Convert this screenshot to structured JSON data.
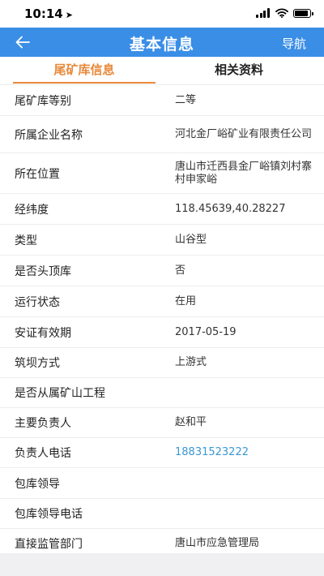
{
  "status_bar": {
    "time": "10:14"
  },
  "nav": {
    "title": "基本信息",
    "right_label": "导航"
  },
  "tabs": [
    {
      "label": "尾矿库信息",
      "active": true
    },
    {
      "label": "相关资料",
      "active": false
    }
  ],
  "rows": [
    {
      "label": "尾矿库等别",
      "value": "二等"
    },
    {
      "label": "所属企业名称",
      "value": "河北金厂峪矿业有限责任公司"
    },
    {
      "label": "所在位置",
      "value": "唐山市迁西县金厂峪镇刘村寨村申家峪"
    },
    {
      "label": "经纬度",
      "value": "118.45639,40.28227"
    },
    {
      "label": "类型",
      "value": "山谷型"
    },
    {
      "label": "是否头顶库",
      "value": "否"
    },
    {
      "label": "运行状态",
      "value": "在用"
    },
    {
      "label": "安证有效期",
      "value": "2017-05-19"
    },
    {
      "label": "筑坝方式",
      "value": "上游式"
    },
    {
      "label": "是否从属矿山工程",
      "value": ""
    },
    {
      "label": "主要负责人",
      "value": "赵和平"
    },
    {
      "label": "负责人电话",
      "value": "18831523222"
    },
    {
      "label": "包库领导",
      "value": ""
    },
    {
      "label": "包库领导电话",
      "value": ""
    },
    {
      "label": "直接监管部门",
      "value": "唐山市应急管理局"
    }
  ],
  "colors": {
    "nav_bg": "#3a8ee6",
    "tab_active": "#e8893a",
    "link": "#3a97d4"
  },
  "icons": {
    "back": "arrow-left-icon",
    "location": "location-arrow-icon",
    "signal": "signal-icon",
    "wifi": "wifi-icon",
    "battery": "battery-icon"
  }
}
